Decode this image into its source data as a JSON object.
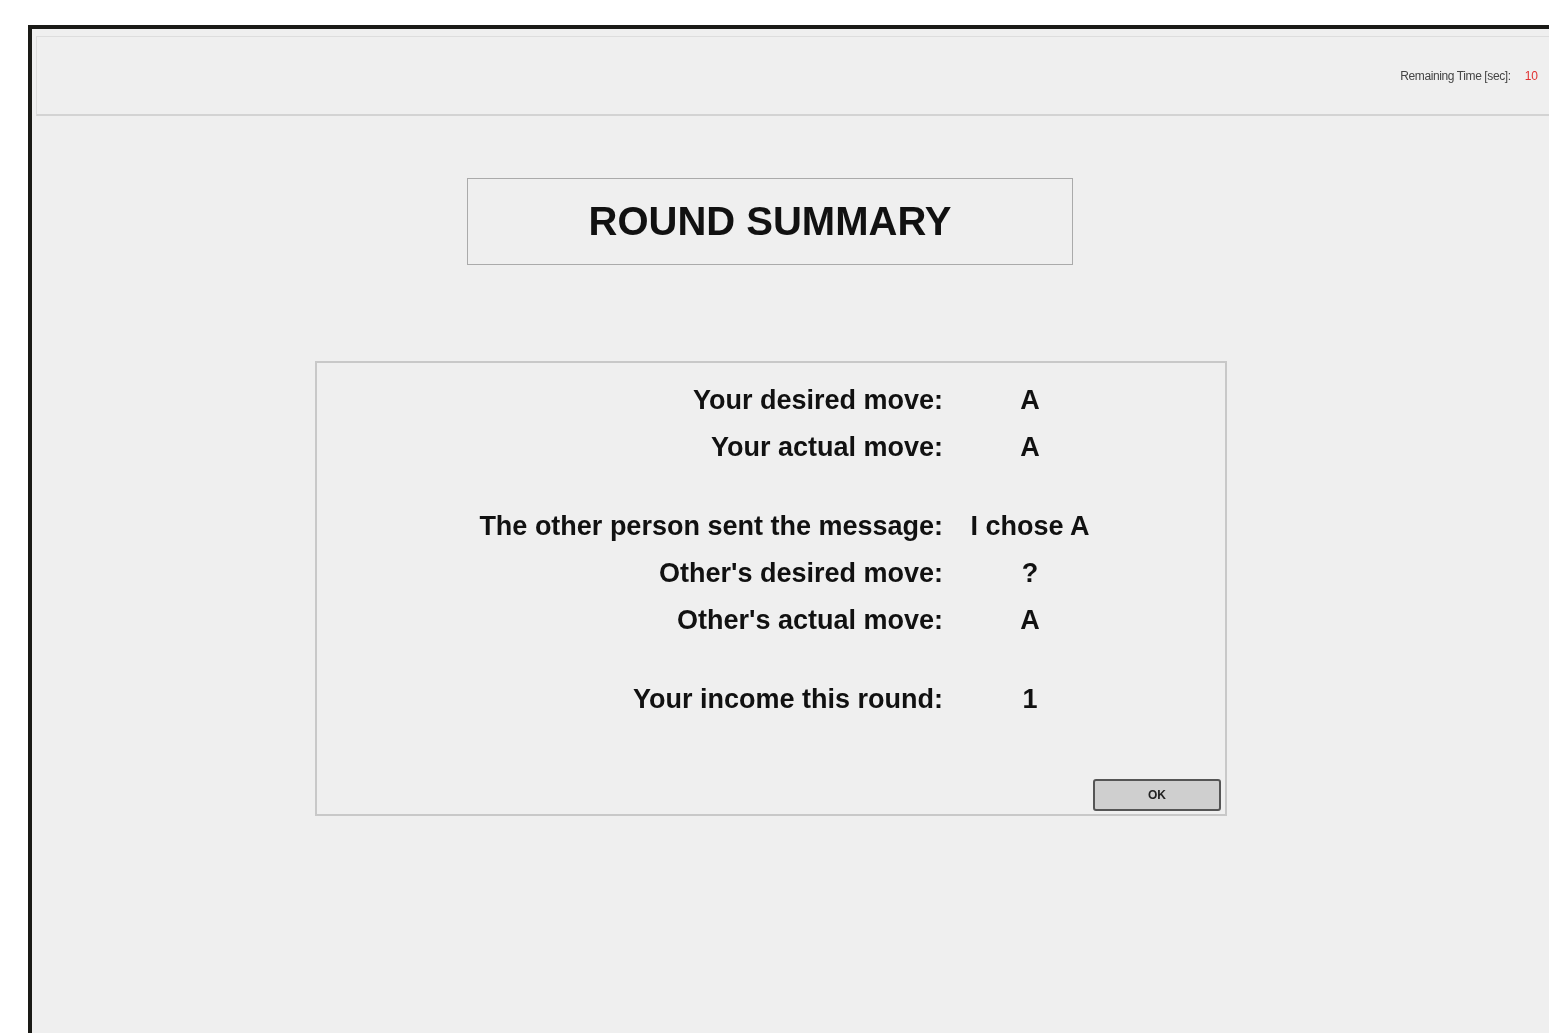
{
  "header": {
    "timer_label": "Remaining Time [sec]:",
    "timer_value": "10"
  },
  "title": "ROUND SUMMARY",
  "summary": {
    "groups": [
      [
        {
          "label": "Your desired move:",
          "value": "A"
        },
        {
          "label": "Your actual move:",
          "value": "A"
        }
      ],
      [
        {
          "label": "The other person sent the message:",
          "value": "I chose A"
        },
        {
          "label": "Other's desired move:",
          "value": "?"
        },
        {
          "label": "Other's actual move:",
          "value": "A"
        }
      ],
      [
        {
          "label": "Your income this round:",
          "value": "1"
        }
      ]
    ]
  },
  "buttons": [
    "OK"
  ]
}
